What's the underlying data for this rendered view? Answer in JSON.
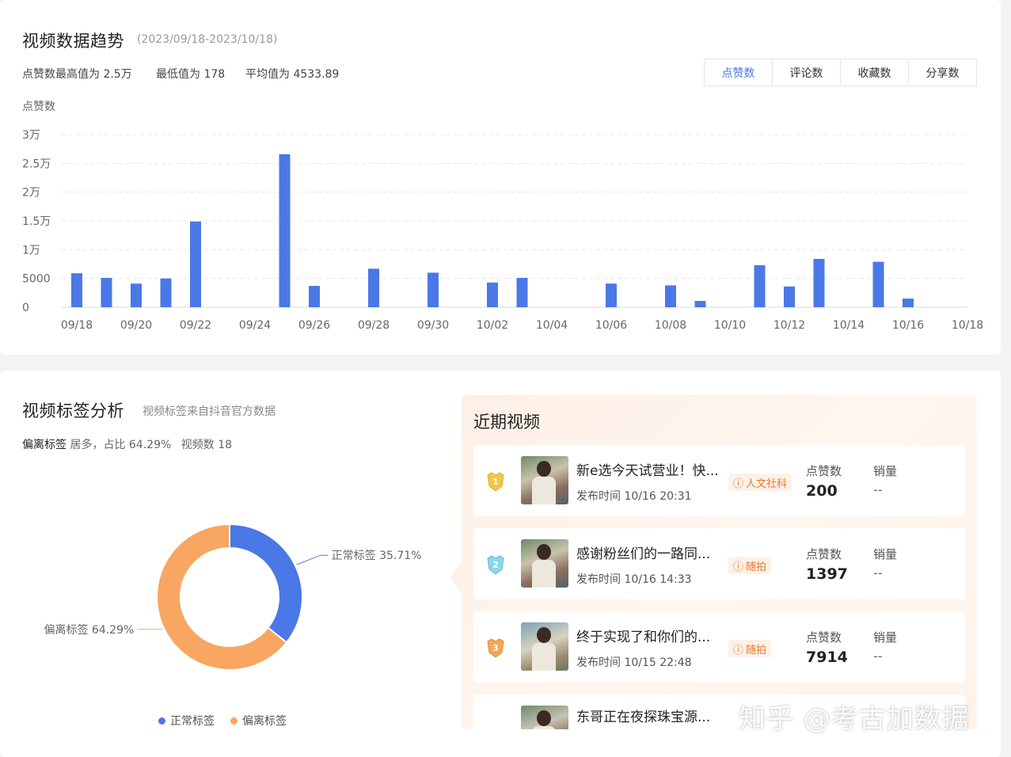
{
  "trend": {
    "title": "视频数据趋势",
    "date_range": "(2023/09/18-2023/10/18)",
    "stats": {
      "max": "点赞数最高值为 2.5万",
      "min": "最低值为 178",
      "avg": "平均值为 4533.89"
    },
    "tabs": [
      "点赞数",
      "评论数",
      "收藏数",
      "分享数"
    ],
    "active_tab": 0
  },
  "chart_data": [
    {
      "type": "bar",
      "ylabel": "点赞数",
      "ylim": [
        0,
        30000
      ],
      "yticks": [
        0,
        5000,
        10000,
        15000,
        20000,
        25000,
        30000
      ],
      "ytick_labels": [
        "0",
        "5000",
        "1万",
        "1.5万",
        "2万",
        "2.5万",
        "3万"
      ],
      "grid": true,
      "xtick_labels": [
        "09/18",
        "09/20",
        "09/22",
        "09/24",
        "09/26",
        "09/28",
        "09/30",
        "10/02",
        "10/04",
        "10/06",
        "10/08",
        "10/10",
        "10/12",
        "10/14",
        "10/16",
        "10/18"
      ],
      "categories": [
        "09/18",
        "09/19",
        "09/20",
        "09/21",
        "09/22",
        "09/23",
        "09/24",
        "09/25",
        "09/26",
        "09/27",
        "09/28",
        "09/29",
        "09/30",
        "10/01",
        "10/02",
        "10/03",
        "10/04",
        "10/05",
        "10/06",
        "10/07",
        "10/08",
        "10/09",
        "10/10",
        "10/11",
        "10/12",
        "10/13",
        "10/14",
        "10/15",
        "10/16",
        "10/17",
        "10/18"
      ],
      "values": [
        5900,
        5100,
        4100,
        5000,
        14900,
        0,
        0,
        26600,
        3700,
        0,
        6700,
        0,
        6000,
        0,
        4300,
        5100,
        0,
        0,
        4100,
        0,
        3800,
        1100,
        0,
        7300,
        3600,
        8400,
        0,
        7900,
        1500,
        0,
        0
      ],
      "color": "#4a78e6"
    },
    {
      "type": "pie",
      "labels": [
        "正常标签",
        "偏离标签"
      ],
      "values": [
        35.71,
        64.29
      ],
      "value_labels": [
        "35.71%",
        "64.29%"
      ],
      "colors": [
        "#4a78e6",
        "#f8a662"
      ],
      "donut": true,
      "legend": "bottom"
    }
  ],
  "tags": {
    "title": "视频标签分析",
    "subtitle": "视频标签来自抖音官方数据",
    "summary_label": "偏离标签",
    "summary_rest": "居多，占比 64.29%",
    "count_text": "视频数 18"
  },
  "recent": {
    "title": "近期视频",
    "likes_label": "点赞数",
    "sales_label": "销量",
    "videos": [
      {
        "rank": "1",
        "title": "新e选今天试营业！快...",
        "time": "发布时间 10/16 20:31",
        "tag": "人文社科",
        "likes": "200",
        "sales": "--"
      },
      {
        "rank": "2",
        "title": "感谢粉丝们的一路同...",
        "time": "发布时间 10/16 14:33",
        "tag": "随拍",
        "likes": "1397",
        "sales": "--"
      },
      {
        "rank": "3",
        "title": "终于实现了和你们的...",
        "time": "发布时间 10/15 22:48",
        "tag": "随拍",
        "likes": "7914",
        "sales": "--"
      },
      {
        "title": "东哥正在夜探珠宝源..."
      }
    ]
  },
  "watermark": "知乎 @考古加数据"
}
